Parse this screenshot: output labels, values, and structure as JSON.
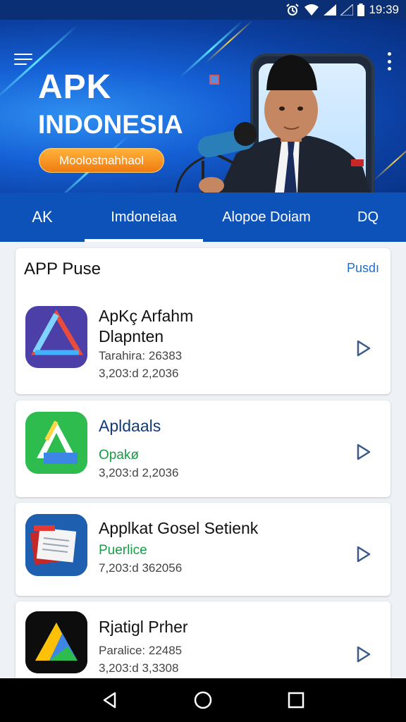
{
  "status_bar": {
    "time": "19:39"
  },
  "hero": {
    "title_line1": "APK",
    "title_line2": "INDONESIA",
    "cta_label": "Moolostnahhaol"
  },
  "tabs": [
    {
      "label": "AK"
    },
    {
      "label": "Imdoneiaa"
    },
    {
      "label": "Alopoe Doiam"
    },
    {
      "label": "DQ"
    }
  ],
  "section": {
    "title": "APP Puse",
    "link": "Pusdı"
  },
  "apps": [
    {
      "name_line1": "ApKç Arfahm",
      "name_line2": "Dlapnten",
      "info1": "Tarahira: 26383",
      "info2": "3,203:d 2,2036"
    },
    {
      "name_line1": "Apldaals",
      "info1": "Opakø",
      "info2": "3,203:d 2,2036"
    },
    {
      "name_line1": "Applkat Gosel Setienk",
      "info1": "Puerlice",
      "info2": "7,203:d 362056"
    },
    {
      "name_line1": "Rjatigl Prher",
      "info1": "Paralice: 22485",
      "info2": "3,203:d 3,3308"
    }
  ],
  "colors": {
    "primary": "#0d52b8",
    "accent": "#f07b12",
    "link": "#1f6fd1",
    "green": "#1a9a47"
  }
}
